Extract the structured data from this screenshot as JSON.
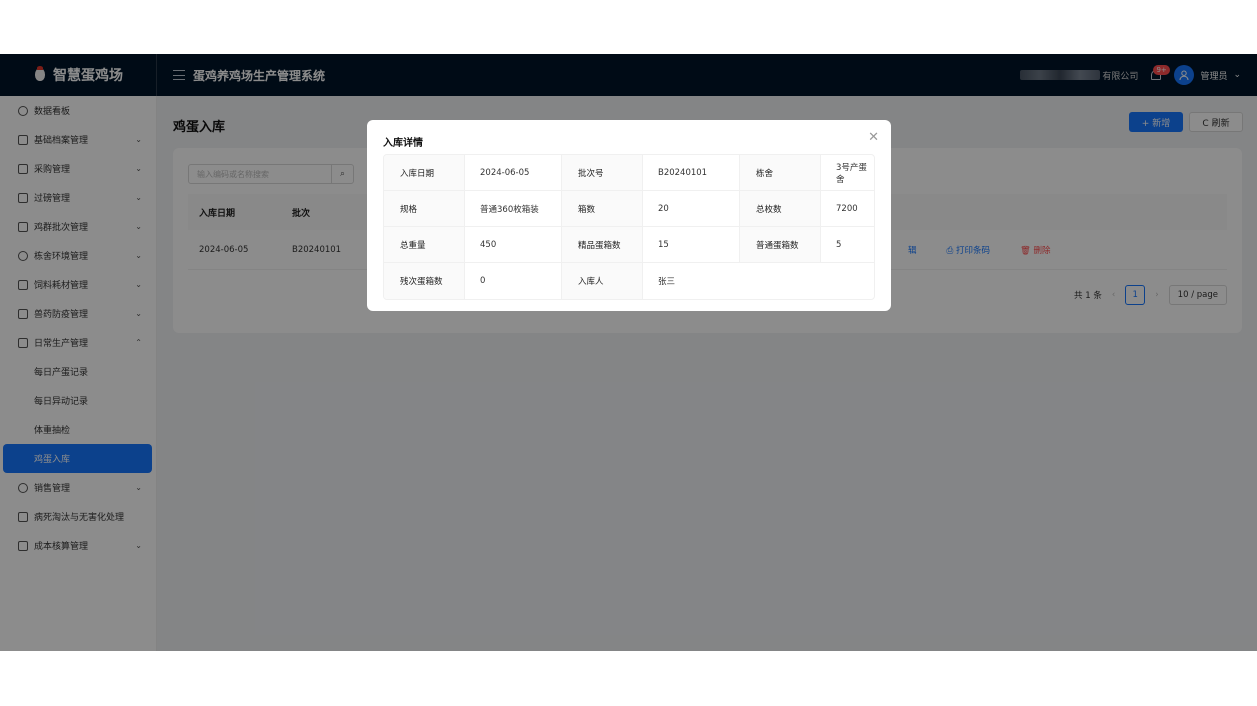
{
  "app": {
    "logo_text": "智慧蛋鸡场",
    "system_title": "蛋鸡养鸡场生产管理系统",
    "company_suffix": "有限公司",
    "notification_badge": "9+",
    "user_name": "管理员"
  },
  "sidebar": {
    "items": [
      {
        "label": "数据看板"
      },
      {
        "label": "基础档案管理"
      },
      {
        "label": "采购管理"
      },
      {
        "label": "过磅管理"
      },
      {
        "label": "鸡群批次管理"
      },
      {
        "label": "栋舍环境管理"
      },
      {
        "label": "饲料耗材管理"
      },
      {
        "label": "兽药防疫管理"
      },
      {
        "label": "日常生产管理"
      },
      {
        "label": "销售管理"
      },
      {
        "label": "病死淘汰与无害化处理"
      },
      {
        "label": "成本核算管理"
      }
    ],
    "sub_items": [
      {
        "label": "每日产蛋记录"
      },
      {
        "label": "每日异动记录"
      },
      {
        "label": "体重抽检"
      },
      {
        "label": "鸡蛋入库"
      }
    ]
  },
  "page": {
    "title": "鸡蛋入库",
    "new_button": "+ 新增",
    "refresh_button": "C 刷新",
    "search_placeholder": "输入编码或名称搜索",
    "columns": [
      "入库日期",
      "批次"
    ],
    "row": {
      "date": "2024-06-05",
      "batch": "B20240101"
    },
    "actions": [
      "辑",
      "打印条码",
      "删除"
    ],
    "pager": {
      "total": "共 1 条",
      "current": "1",
      "page_size": "10 / page"
    }
  },
  "modal": {
    "title": "入库详情",
    "rows": [
      [
        {
          "label": "入库日期",
          "value": "2024-06-05"
        },
        {
          "label": "批次号",
          "value": "B20240101"
        },
        {
          "label": "栋舍",
          "value": "3号产蛋舍"
        }
      ],
      [
        {
          "label": "规格",
          "value": "普通360枚箱装"
        },
        {
          "label": "箱数",
          "value": "20"
        },
        {
          "label": "总枚数",
          "value": "7200"
        }
      ],
      [
        {
          "label": "总重量",
          "value": "450"
        },
        {
          "label": "精品蛋箱数",
          "value": "15"
        },
        {
          "label": "普通蛋箱数",
          "value": "5"
        }
      ],
      [
        {
          "label": "残次蛋箱数",
          "value": "0"
        },
        {
          "label": "入库人",
          "value": "张三"
        }
      ]
    ]
  }
}
